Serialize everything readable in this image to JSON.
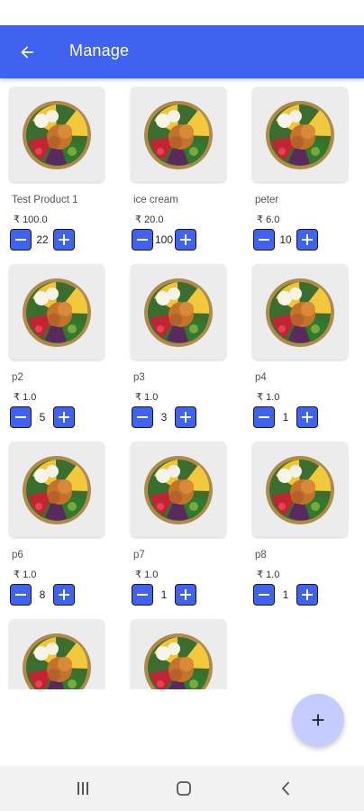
{
  "app": {
    "title": "Manage"
  },
  "currency_symbol": "₹",
  "products": [
    {
      "name": "Test Product 1",
      "price": "100.0",
      "qty": "22"
    },
    {
      "name": "ice cream",
      "price": "20.0",
      "qty": "100"
    },
    {
      "name": "peter",
      "price": "6.0",
      "qty": "10"
    },
    {
      "name": "p2",
      "price": "1.0",
      "qty": "5"
    },
    {
      "name": "p3",
      "price": "1.0",
      "qty": "3"
    },
    {
      "name": "p4",
      "price": "1.0",
      "qty": "1"
    },
    {
      "name": "p6",
      "price": "1.0",
      "qty": "8"
    },
    {
      "name": "p7",
      "price": "1.0",
      "qty": "1"
    },
    {
      "name": "p8",
      "price": "1.0",
      "qty": "1"
    },
    {
      "name": "",
      "price": "",
      "qty": ""
    },
    {
      "name": "",
      "price": "",
      "qty": ""
    }
  ],
  "icons": {
    "back": "arrow-left-icon",
    "minus": "minus-icon",
    "plus": "plus-icon",
    "fab": "plus-icon",
    "nav_recents": "recents-icon",
    "nav_home": "home-icon",
    "nav_back": "chevron-left-icon"
  },
  "colors": {
    "primary": "#3f63f0",
    "fab": "#c5ccff",
    "navbar": "#f2f2f2"
  }
}
